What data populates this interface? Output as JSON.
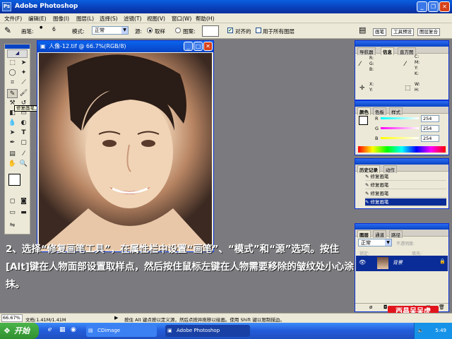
{
  "app": {
    "title": "Adobe Photoshop",
    "ps_icon": "Ps"
  },
  "menu": [
    "文件(F)",
    "编辑(E)",
    "图像(I)",
    "图层(L)",
    "选择(S)",
    "滤镜(T)",
    "视图(V)",
    "窗口(W)",
    "帮助(H)"
  ],
  "options": {
    "brush_label": "画笔:",
    "brush_size": "6",
    "mode_label": "模式:",
    "mode_value": "正常",
    "source_label": "源:",
    "sampled_label": "取样",
    "pattern_label": "图案:",
    "aligned_label": "对齐的",
    "all_layers_label": "用于所有图层",
    "tab_brushes": "画笔",
    "tab_tool_presets": "工具预设",
    "tab_layer_comps": "图层复合"
  },
  "toolbox": {
    "tooltip": "修复画笔工具 (J)"
  },
  "document": {
    "title": "人像-12.tif @ 66.7%(RGB/8)"
  },
  "navigator": {
    "tabs": [
      "导航器",
      "信息",
      "直方图"
    ],
    "labels": [
      "R:",
      "G:",
      "B:",
      "C:",
      "M:",
      "Y:",
      "K:",
      "X:",
      "Y:",
      "W:",
      "H:"
    ]
  },
  "color": {
    "tabs": [
      "颜色",
      "色板",
      "样式"
    ],
    "r_label": "R",
    "g_label": "G",
    "b_label": "B",
    "r_value": "254",
    "g_value": "254",
    "b_value": "254"
  },
  "history": {
    "tabs": [
      "历史记录",
      "动作"
    ],
    "rows": [
      "修复画笔",
      "修复画笔",
      "修复画笔",
      "修复画笔"
    ]
  },
  "layers": {
    "tabs": [
      "图层",
      "通道",
      "路径"
    ],
    "blend_mode": "正常",
    "opacity_label": "不透明度:",
    "lock_label": "锁定:",
    "fill_label": "填充:",
    "layer_name": "背景"
  },
  "caption": "2、选择“修复画笔工具”，在属性栏中设置“画笔”、“模式”和“源”选项。按住[Alt]键在人物面部设置取样点，然后按住鼠标左键在人物需要移除的皱纹处小心涂抹。",
  "status": {
    "zoom": "66.67%",
    "doc": "文档:1.41M/1.41M",
    "hint": "按住 Alt 键点按以定义源，然后点按并拖移以绘画。使用 Shift 键以限制描边。"
  },
  "taskbar": {
    "start": "开始",
    "task1": "CDimage",
    "task2": "Adobe Photoshop",
    "clock": "5:49"
  },
  "watermark": "西昌呆呆虎",
  "colors": {
    "title_blue": "#0a3fb8",
    "ui_gray": "#ece9d8",
    "canvas_gray": "#7b7b7f",
    "taskbar_blue": "#245edb",
    "start_green": "#2f8f2f",
    "logo_red": "#e1141c"
  }
}
